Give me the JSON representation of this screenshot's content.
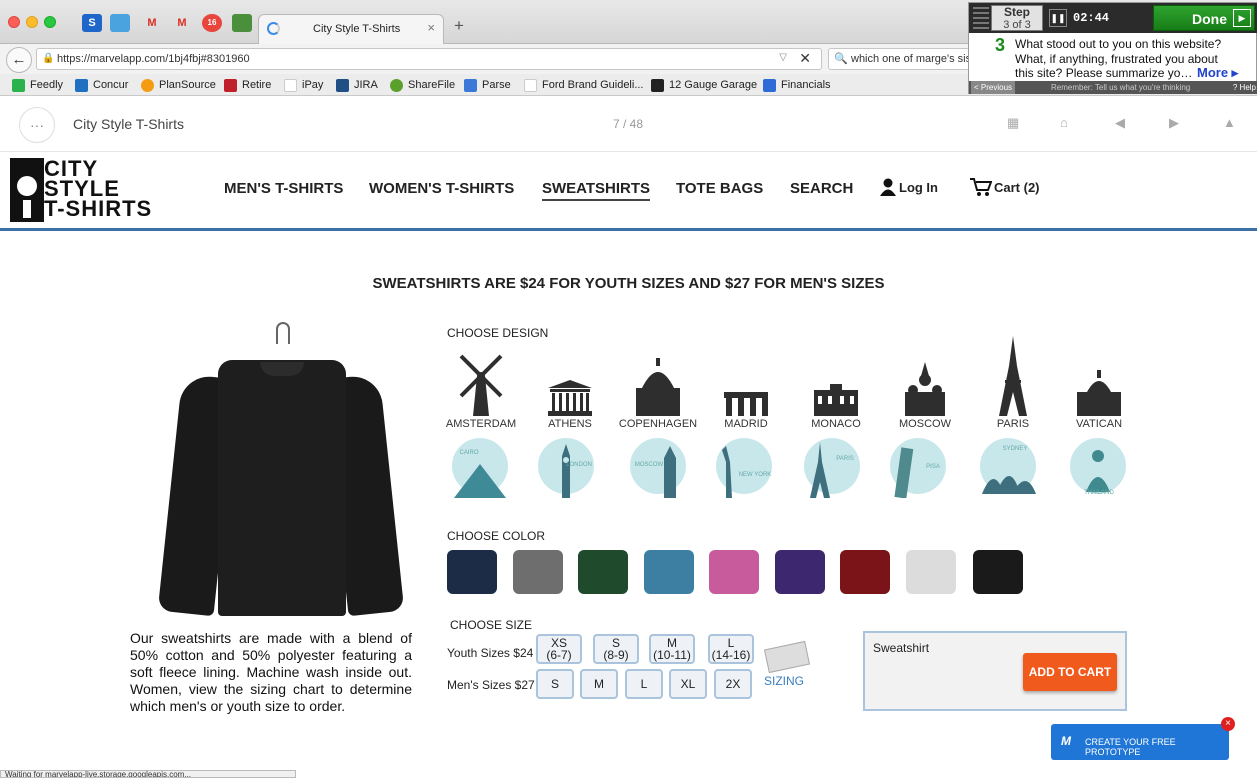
{
  "browser": {
    "tab_title": "City Style T-Shirts",
    "url": "https://marvelapp.com/1bj4fbj#8301960",
    "search_text": "which one of marge's sisters",
    "status_text": "Waiting for marvelapp-live.storage.googleapis.com...",
    "pinned_tabs": [
      {
        "icon": "outlook-icon",
        "label": "",
        "color": "#1e66c9"
      },
      {
        "icon": "grid-icon",
        "label": "",
        "color": "#4aa3df"
      },
      {
        "icon": "gmail-icon",
        "label": "M",
        "color": "#d93025"
      },
      {
        "icon": "gmail-icon",
        "label": "M",
        "color": "#d93025"
      },
      {
        "icon": "badge-icon",
        "label": "16",
        "color": "#e8453c"
      },
      {
        "icon": "shirt-icon",
        "label": "",
        "color": "#4a8f3c"
      }
    ],
    "bookmarks": [
      {
        "label": "Feedly",
        "color": "#2bb24c"
      },
      {
        "label": "Concur",
        "color": "#1f70c1"
      },
      {
        "label": "PlanSource",
        "color": "#f39c12"
      },
      {
        "label": "Retire",
        "color": "#c0202a"
      },
      {
        "label": "iPay",
        "color": "#dddddd"
      },
      {
        "label": "JIRA",
        "color": "#1f4f85"
      },
      {
        "label": "ShareFile",
        "color": "#5aa02c"
      },
      {
        "label": "Parse",
        "color": "#3c78d8"
      },
      {
        "label": "Ford Brand Guideli...",
        "color": "#dddddd"
      },
      {
        "label": "12 Gauge Garage",
        "color": "#222222"
      },
      {
        "label": "Financials",
        "color": "#2f6bd6"
      }
    ]
  },
  "study": {
    "step_label": "Step",
    "step_count": "3 of 3",
    "timer": "02:44",
    "done_label": "Done",
    "question_number": "3",
    "question": "What stood out to you on this website? What, if anything, frustrated you about this site? Please summarize yo…",
    "more_label": "More ▸",
    "previous_label": "< Previous",
    "reminder": "Remember: Tell us what you're thinking",
    "help_label": "? Help"
  },
  "marvel": {
    "project_title": "City Style T-Shirts",
    "page_counter": "7 / 48"
  },
  "site": {
    "logo_lines": [
      "CITY",
      "STYLE",
      "T-SHIRTS"
    ],
    "nav": [
      "MEN'S T-SHIRTS",
      "WOMEN'S T-SHIRTS",
      "SWEATSHIRTS",
      "TOTE BAGS",
      "SEARCH"
    ],
    "login_label": "Log In",
    "cart_label": "Cart (2)",
    "headline": "SWEATSHIRTS ARE $24 FOR YOUTH SIZES AND $27 FOR MEN'S SIZES",
    "description": "Our sweatshirts are made with a blend of 50% cotton and 50% polyester featuring a soft fleece lining. Machine wash inside out. Women, view the sizing chart to determine which men's or youth size to order.",
    "choose_design_label": "CHOOSE DESIGN",
    "designs": [
      "AMSTERDAM",
      "ATHENS",
      "COPENHAGEN",
      "MADRID",
      "MONACO",
      "MOSCOW",
      "PARIS",
      "VATICAN"
    ],
    "circle_designs": [
      "CAIRO",
      "LONDON",
      "MOSCOW",
      "NEW YORK",
      "PARIS",
      "PISA",
      "SYDNEY",
      "THAILAND"
    ],
    "choose_color_label": "CHOOSE COLOR",
    "colors": [
      "#1c2b46",
      "#6e6e6e",
      "#1f4a2c",
      "#3c7fa3",
      "#c85b9c",
      "#3d2870",
      "#7a1418",
      "#dcdcdc",
      "#1a1a1a"
    ],
    "choose_size_label": "CHOOSE SIZE",
    "youth_label": "Youth Sizes $24",
    "mens_label": "Men's Sizes $27",
    "youth_sizes": [
      {
        "size": "XS",
        "range": "(6-7)"
      },
      {
        "size": "S",
        "range": "(8-9)"
      },
      {
        "size": "M",
        "range": "(10-11)"
      },
      {
        "size": "L",
        "range": "(14-16)"
      }
    ],
    "mens_sizes": [
      "S",
      "M",
      "L",
      "XL",
      "2X"
    ],
    "sizing_label": "SIZING",
    "product_name": "Sweatshirt",
    "add_to_cart_label": "ADD TO CART",
    "prototype_label": "CREATE YOUR FREE PROTOTYPE"
  }
}
